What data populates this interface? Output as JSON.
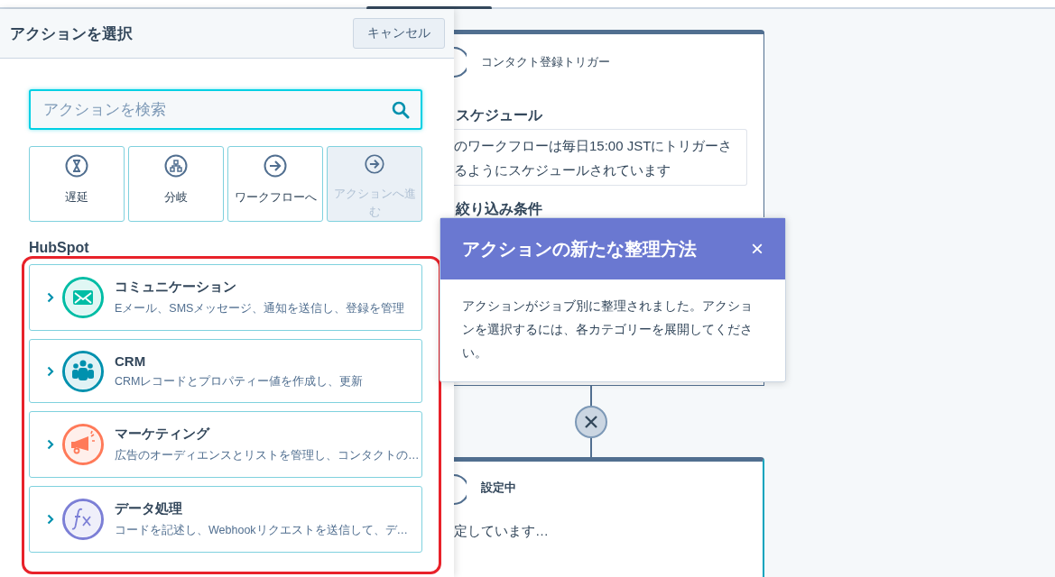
{
  "panel": {
    "title": "アクションを選択",
    "cancel_button": "キャンセル",
    "search": {
      "placeholder": "アクションを検索"
    },
    "quick_actions": [
      {
        "label": "遅延",
        "kind": "delay",
        "disabled": false
      },
      {
        "label": "分岐",
        "kind": "branch",
        "disabled": false
      },
      {
        "label": "ワークフローへ",
        "kind": "goto",
        "disabled": false
      },
      {
        "label": "アクションへ進む",
        "kind": "goto",
        "disabled": true
      }
    ],
    "section_heading": "HubSpot",
    "categories": [
      {
        "title": "コミュニケーション",
        "description": "Eメール、SMSメッセージ、通知を送信し、登録を管理",
        "kind": "mail",
        "color": "#00bda5"
      },
      {
        "title": "CRM",
        "description": "CRMレコードとプロパティー値を作成し、更新",
        "kind": "people",
        "color": "#0091ae"
      },
      {
        "title": "マーケティング",
        "description": "広告のオーディエンスとリストを管理し、コンタクトの…",
        "kind": "megaphone",
        "color": "#ff7a59"
      },
      {
        "title": "データ処理",
        "description": "コードを記述し、Webhookリクエストを送信して、デ…",
        "kind": "formula",
        "color": "#7c7fd6"
      }
    ]
  },
  "canvas": {
    "trigger_card": {
      "title": "コンタクト登録トリガー",
      "section": "スケジュール",
      "schedule_lines": [
        "のワークフローは毎日15:00 JSTにトリガーさ",
        "るようにスケジュールされています"
      ],
      "filter_heading": "絞り込み条件"
    },
    "action_card": {
      "title": "設定中",
      "text": "定しています…"
    }
  },
  "popover": {
    "title": "アクションの新たな整理方法",
    "close": "×",
    "body": "アクションがジョブ別に整理されました。アクションを選択するには、各カテゴリーを展開してください。"
  }
}
